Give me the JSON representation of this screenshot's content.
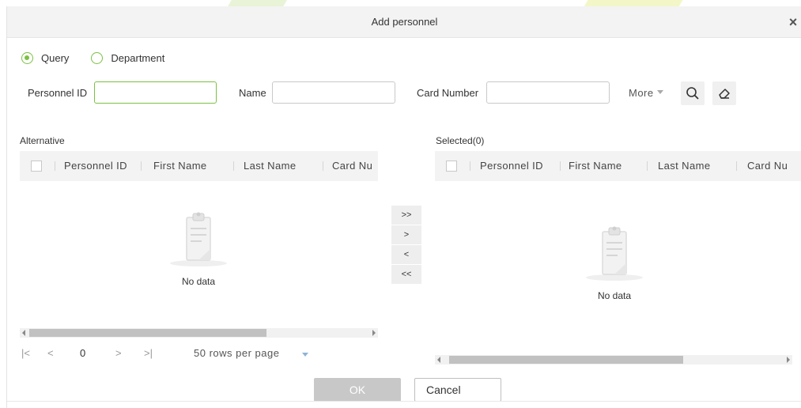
{
  "dialog": {
    "title": "Add personnel",
    "close_glyph": "×"
  },
  "mode": {
    "options": [
      {
        "label": "Query",
        "selected": true
      },
      {
        "label": "Department",
        "selected": false
      }
    ]
  },
  "query": {
    "personnel_id_label": "Personnel ID",
    "personnel_id_value": "",
    "name_label": "Name",
    "name_value": "",
    "card_number_label": "Card Number",
    "card_number_value": "",
    "more_label": "More",
    "search_icon": "search-icon",
    "clear_icon": "eraser-icon"
  },
  "alternative": {
    "label": "Alternative",
    "columns": [
      "Personnel ID",
      "First Name",
      "Last Name",
      "Card Nu"
    ],
    "empty_text": "No data"
  },
  "selected": {
    "label": "Selected(0)",
    "columns": [
      "Personnel ID",
      "First Name",
      "Last Name",
      "Card Nu"
    ],
    "empty_text": "No data"
  },
  "transfer": {
    "add_all": ">>",
    "add": ">",
    "remove": "<",
    "remove_all": "<<"
  },
  "pager": {
    "first": "|<",
    "prev": "<",
    "page": "0",
    "next": ">",
    "last": ">|",
    "rows_per_page": "50 rows per page"
  },
  "footer": {
    "ok_label": "OK",
    "cancel_label": "Cancel"
  },
  "colors": {
    "accent": "#7ac143",
    "header_bg": "#f3f3f3",
    "ok_disabled": "#c8c8c8"
  }
}
